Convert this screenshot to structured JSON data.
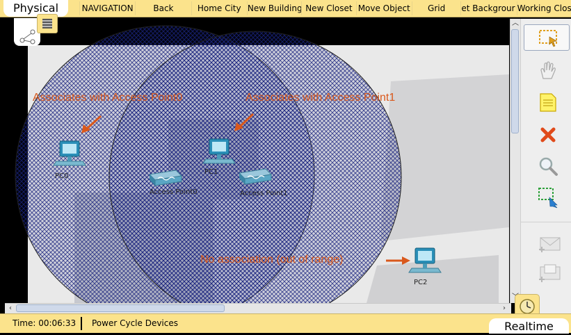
{
  "topbar": {
    "mode_tab": "Physical",
    "nav_items": [
      "NAVIGATION",
      "Back",
      "Home City",
      "New Building",
      "New Closet",
      "Move Object",
      "Grid",
      "et Backgrour",
      "Working Closet"
    ]
  },
  "workspace": {
    "annotations": {
      "ap0": "Associates with Access Point0",
      "ap1": "Associates with Access Point1",
      "none": "No association (out of range)"
    },
    "devices": {
      "pc0": "PC0",
      "pc1": "PC1",
      "pc2": "PC2",
      "ap0": "Access Point0",
      "ap1": "Access Point1"
    }
  },
  "toolbox": {
    "tools": [
      "select-tool",
      "move-layout-tool",
      "place-note-tool",
      "delete-tool",
      "inspect-tool",
      "resize-shape-tool",
      "add-simple-pdu-tool",
      "add-complex-pdu-tool"
    ]
  },
  "bottombar": {
    "time": "Time: 00:06:33",
    "power_cycle": "Power Cycle Devices",
    "mode_tab": "Realtime"
  },
  "colors": {
    "accent_bar": "#fbe38c",
    "annotation": "#d9581c",
    "coverage_hatch": "#1a237e"
  }
}
